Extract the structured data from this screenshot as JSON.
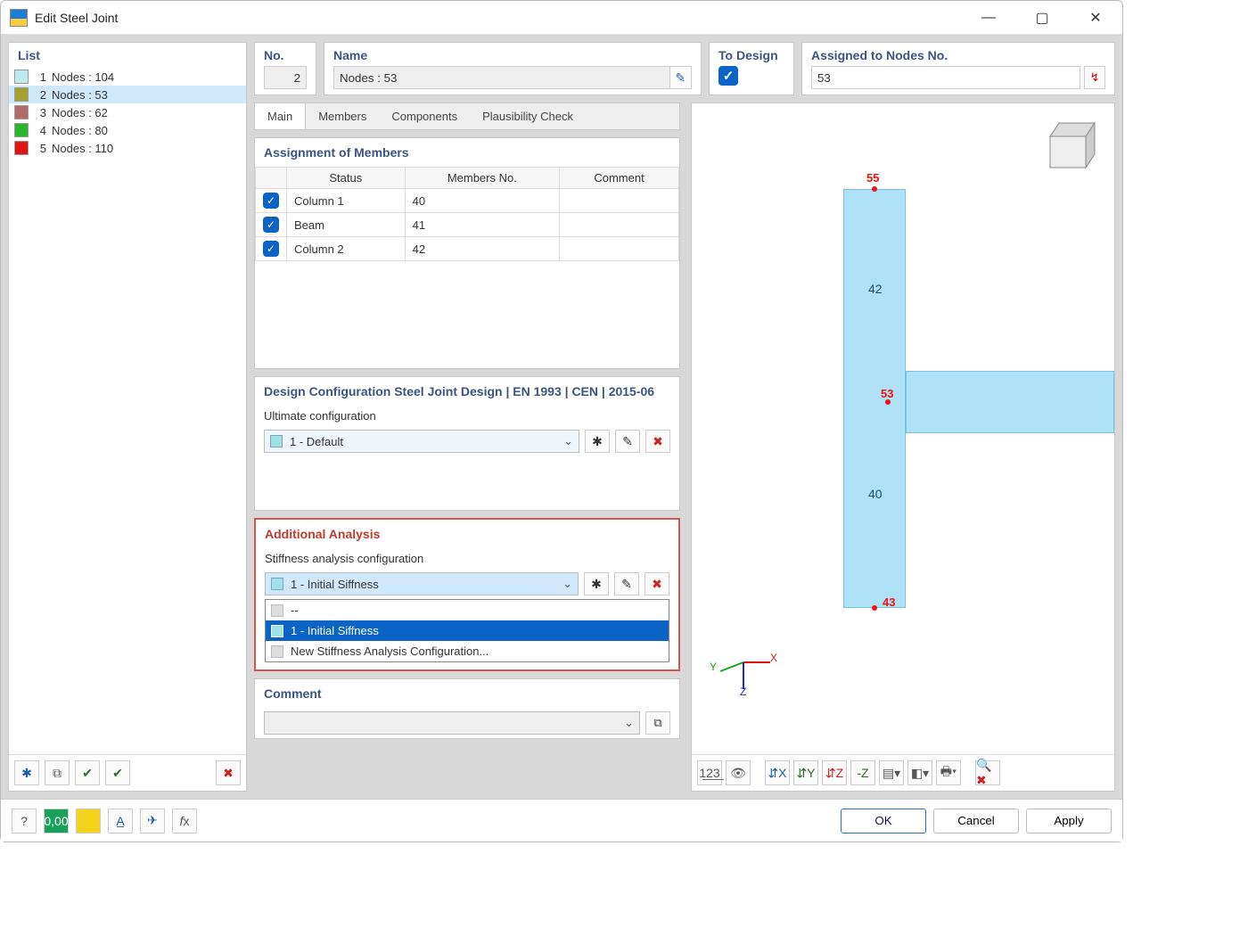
{
  "window": {
    "title": "Edit Steel Joint"
  },
  "list": {
    "header": "List",
    "items": [
      {
        "idx": "1",
        "label": "Nodes : 104",
        "color": "#bdecef",
        "selected": false
      },
      {
        "idx": "2",
        "label": "Nodes : 53",
        "color": "#a8a02e",
        "selected": true
      },
      {
        "idx": "3",
        "label": "Nodes : 62",
        "color": "#b26a6a",
        "selected": false
      },
      {
        "idx": "4",
        "label": "Nodes : 80",
        "color": "#2bb52b",
        "selected": false
      },
      {
        "idx": "5",
        "label": "Nodes : 110",
        "color": "#e11313",
        "selected": false
      }
    ]
  },
  "no": {
    "label": "No.",
    "value": "2"
  },
  "name": {
    "label": "Name",
    "value": "Nodes : 53"
  },
  "to_design": {
    "label": "To Design",
    "checked": true
  },
  "assigned_nodes": {
    "label": "Assigned to Nodes No.",
    "value": "53"
  },
  "tabs": [
    "Main",
    "Members",
    "Components",
    "Plausibility Check"
  ],
  "tabs_active": 0,
  "members_section": {
    "header": "Assignment of Members",
    "cols": [
      "",
      "Status",
      "Members No.",
      "Comment"
    ],
    "rows": [
      {
        "checked": true,
        "status": "Column 1",
        "members_no": "40",
        "comment": ""
      },
      {
        "checked": true,
        "status": "Beam",
        "members_no": "41",
        "comment": ""
      },
      {
        "checked": true,
        "status": "Column 2",
        "members_no": "42",
        "comment": ""
      }
    ]
  },
  "design_config": {
    "header": "Design Configuration Steel Joint Design | EN 1993 | CEN | 2015-06",
    "sub_label": "Ultimate configuration",
    "selected": "1 - Default"
  },
  "additional_analysis": {
    "header": "Additional Analysis",
    "sub_label": "Stiffness analysis configuration",
    "selected": "1 - Initial Siffness",
    "options": [
      {
        "label": "--",
        "selected": false
      },
      {
        "label": "1 - Initial Siffness",
        "selected": true
      },
      {
        "label": "New Stiffness Analysis Configuration...",
        "selected": false
      }
    ]
  },
  "comment_section": {
    "header": "Comment",
    "value": ""
  },
  "view": {
    "node_labels": {
      "top": "55",
      "mid": "53",
      "bot": "43"
    },
    "member_labels": {
      "upper": "42",
      "lower": "40"
    }
  },
  "buttons": {
    "ok": "OK",
    "cancel": "Cancel",
    "apply": "Apply"
  }
}
